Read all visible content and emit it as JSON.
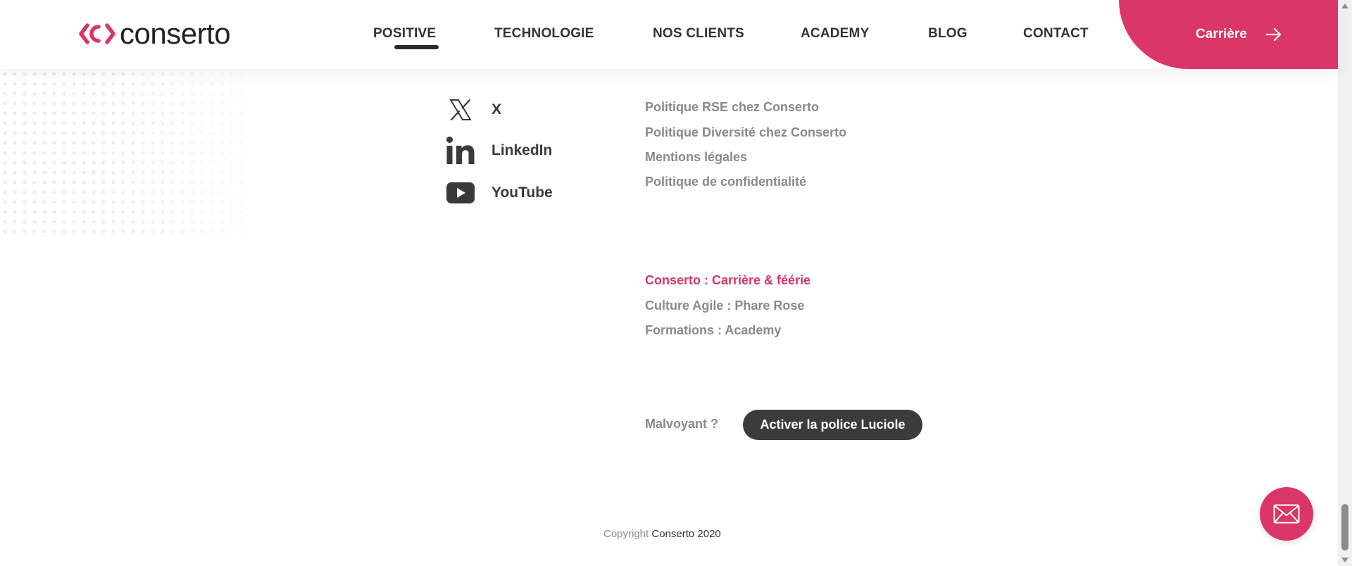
{
  "header": {
    "logo_text": "conserto",
    "nav": [
      {
        "label": "POSITIVE",
        "active": true
      },
      {
        "label": "TECHNOLOGIE"
      },
      {
        "label": "NOS CLIENTS"
      },
      {
        "label": "ACADEMY"
      },
      {
        "label": "BLOG"
      },
      {
        "label": "CONTACT"
      }
    ],
    "cta_label": "Carrière"
  },
  "social": [
    {
      "label": "X",
      "icon": "x-icon"
    },
    {
      "label": "LinkedIn",
      "icon": "linkedin-icon"
    },
    {
      "label": "YouTube",
      "icon": "youtube-icon"
    }
  ],
  "policy_links": [
    "Politique RSE chez Conserto",
    "Politique Diversité chez Conserto",
    "Mentions légales",
    "Politique de confidentialité"
  ],
  "career_links": [
    {
      "label": "Conserto : Carrière & féérie",
      "active": true
    },
    {
      "label": "Culture Agile : Phare Rose"
    },
    {
      "label": "Formations : Academy"
    }
  ],
  "accessibility": {
    "label": "Malvoyant ?",
    "button_label": "Activer la police Luciole"
  },
  "copyright": {
    "prefix": "Copyright ",
    "brand": "Conserto 2020"
  },
  "colors": {
    "accent": "#da3668",
    "dark": "#333333",
    "muted": "#8a8a8a"
  }
}
